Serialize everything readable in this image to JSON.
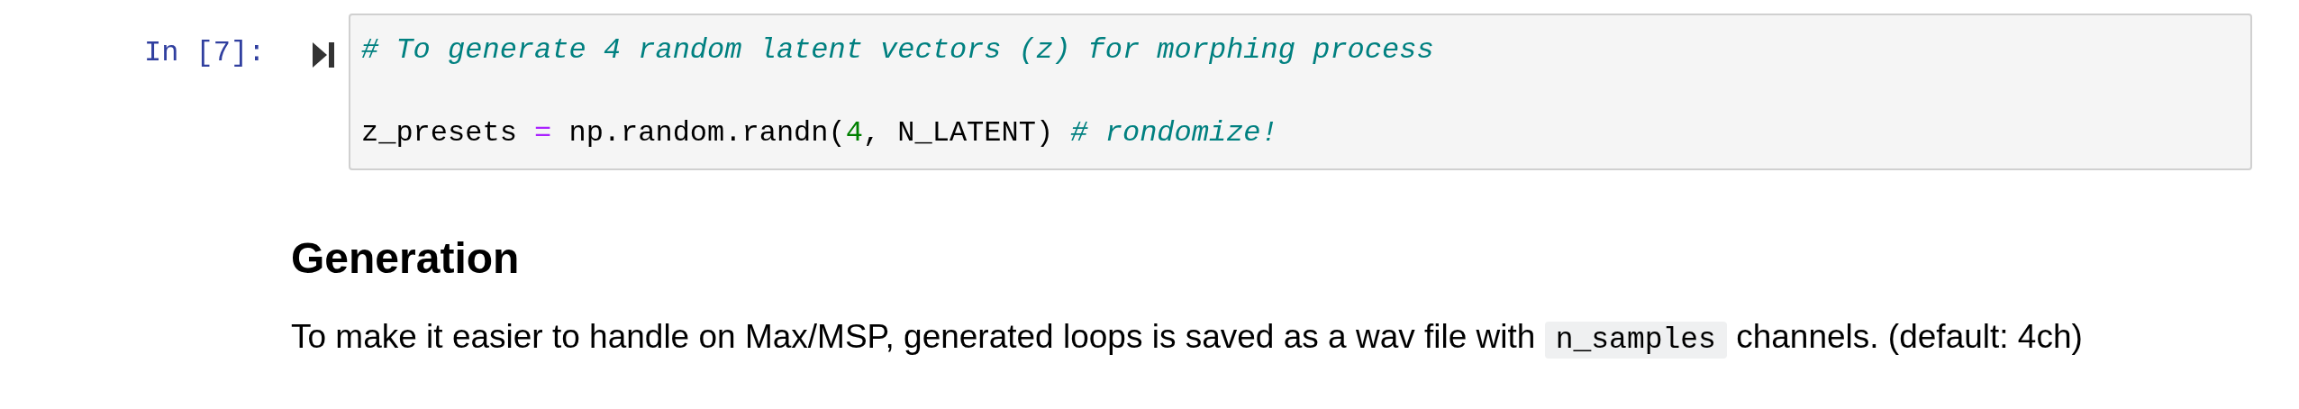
{
  "code_cell": {
    "prompt": "In [7]:",
    "lines": [
      {
        "kind": "code",
        "tokens": [
          {
            "kind": "comment",
            "text": "# To generate 4 random latent vectors (z) for morphing process"
          }
        ]
      },
      {
        "kind": "blank"
      },
      {
        "kind": "code",
        "tokens": [
          {
            "kind": "name",
            "text": "z_presets "
          },
          {
            "kind": "operator",
            "text": "="
          },
          {
            "kind": "name",
            "text": " np.random.randn("
          },
          {
            "kind": "number",
            "text": "4"
          },
          {
            "kind": "name",
            "text": ", N_LATENT) "
          },
          {
            "kind": "comment",
            "text": "# rondomize!"
          }
        ]
      }
    ]
  },
  "markdown_cell": {
    "heading": "Generation",
    "paragraph": [
      {
        "kind": "text",
        "text": "To make it easier to handle on Max/MSP, generated loops is saved as a wav file with"
      },
      {
        "kind": "code",
        "text": "n_samples"
      },
      {
        "kind": "text",
        "text": "channels. (default: 4ch)"
      }
    ]
  }
}
